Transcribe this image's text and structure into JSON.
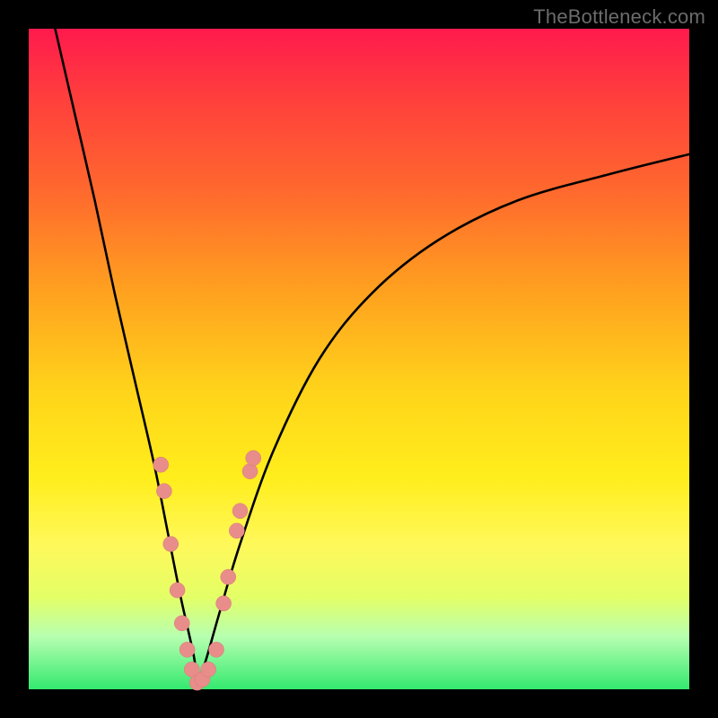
{
  "attribution": "TheBottleneck.com",
  "colors": {
    "background": "#000000",
    "gradient_top": "#ff1a4d",
    "gradient_bottom": "#34e96f",
    "curve": "#000000",
    "marker": "#e88d8a"
  },
  "chart_data": {
    "type": "line",
    "title": "",
    "xlabel": "",
    "ylabel": "",
    "xlim": [
      0,
      100
    ],
    "ylim": [
      0,
      100
    ],
    "x_optimum": 25.5,
    "series": [
      {
        "name": "bottleneck_curve",
        "x": [
          4,
          7,
          10,
          13,
          16,
          19,
          21,
          23,
          25,
          25.5,
          26,
          27,
          29,
          32,
          37,
          44,
          52,
          62,
          74,
          88,
          100
        ],
        "values": [
          100,
          87,
          74,
          60,
          47,
          34,
          24,
          14,
          5,
          1,
          2,
          5,
          12,
          22,
          36,
          50,
          60,
          68,
          74,
          78,
          81
        ]
      }
    ],
    "markers": {
      "left_branch": [
        {
          "x": 20.5,
          "y": 30
        },
        {
          "x": 20.0,
          "y": 34
        },
        {
          "x": 21.5,
          "y": 22
        },
        {
          "x": 22.5,
          "y": 15
        },
        {
          "x": 23.2,
          "y": 10
        },
        {
          "x": 24.0,
          "y": 6
        },
        {
          "x": 24.7,
          "y": 3
        }
      ],
      "bottom": [
        {
          "x": 25.5,
          "y": 1
        },
        {
          "x": 26.3,
          "y": 1.5
        },
        {
          "x": 27.2,
          "y": 3
        },
        {
          "x": 28.4,
          "y": 6
        }
      ],
      "right_branch": [
        {
          "x": 29.5,
          "y": 13
        },
        {
          "x": 30.2,
          "y": 17
        },
        {
          "x": 31.5,
          "y": 24
        },
        {
          "x": 32.0,
          "y": 27
        },
        {
          "x": 33.5,
          "y": 33
        },
        {
          "x": 34.0,
          "y": 35
        }
      ]
    }
  }
}
